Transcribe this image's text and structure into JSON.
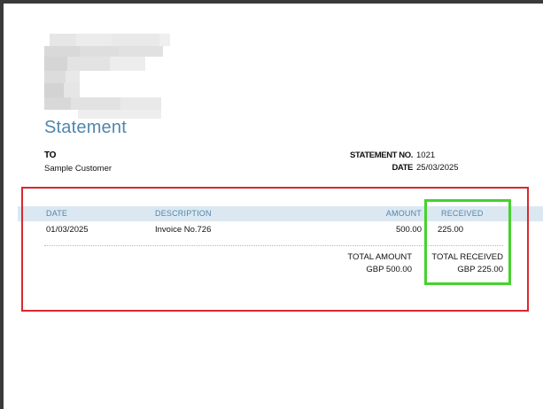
{
  "document": {
    "title": "Statement",
    "to_label": "TO",
    "to_value": "Sample Customer",
    "statement_no_label": "STATEMENT NO.",
    "statement_no_value": "1021",
    "date_label": "DATE",
    "date_value": "25/03/2025"
  },
  "table": {
    "headers": {
      "date": "DATE",
      "description": "DESCRIPTION",
      "amount": "AMOUNT",
      "received": "RECEIVED"
    },
    "rows": [
      {
        "date": "01/03/2025",
        "description": "Invoice No.726",
        "amount": "500.00",
        "received": "225.00"
      }
    ],
    "totals": {
      "total_amount_label": "TOTAL AMOUNT",
      "total_amount_value": "GBP 500.00",
      "total_received_label": "TOTAL RECEIVED",
      "total_received_value": "GBP 225.00"
    }
  },
  "colors": {
    "accent": "#4f86b0",
    "header_fill": "#dce8f1",
    "highlight_red": "#d9282f",
    "highlight_green": "#46d12f"
  }
}
